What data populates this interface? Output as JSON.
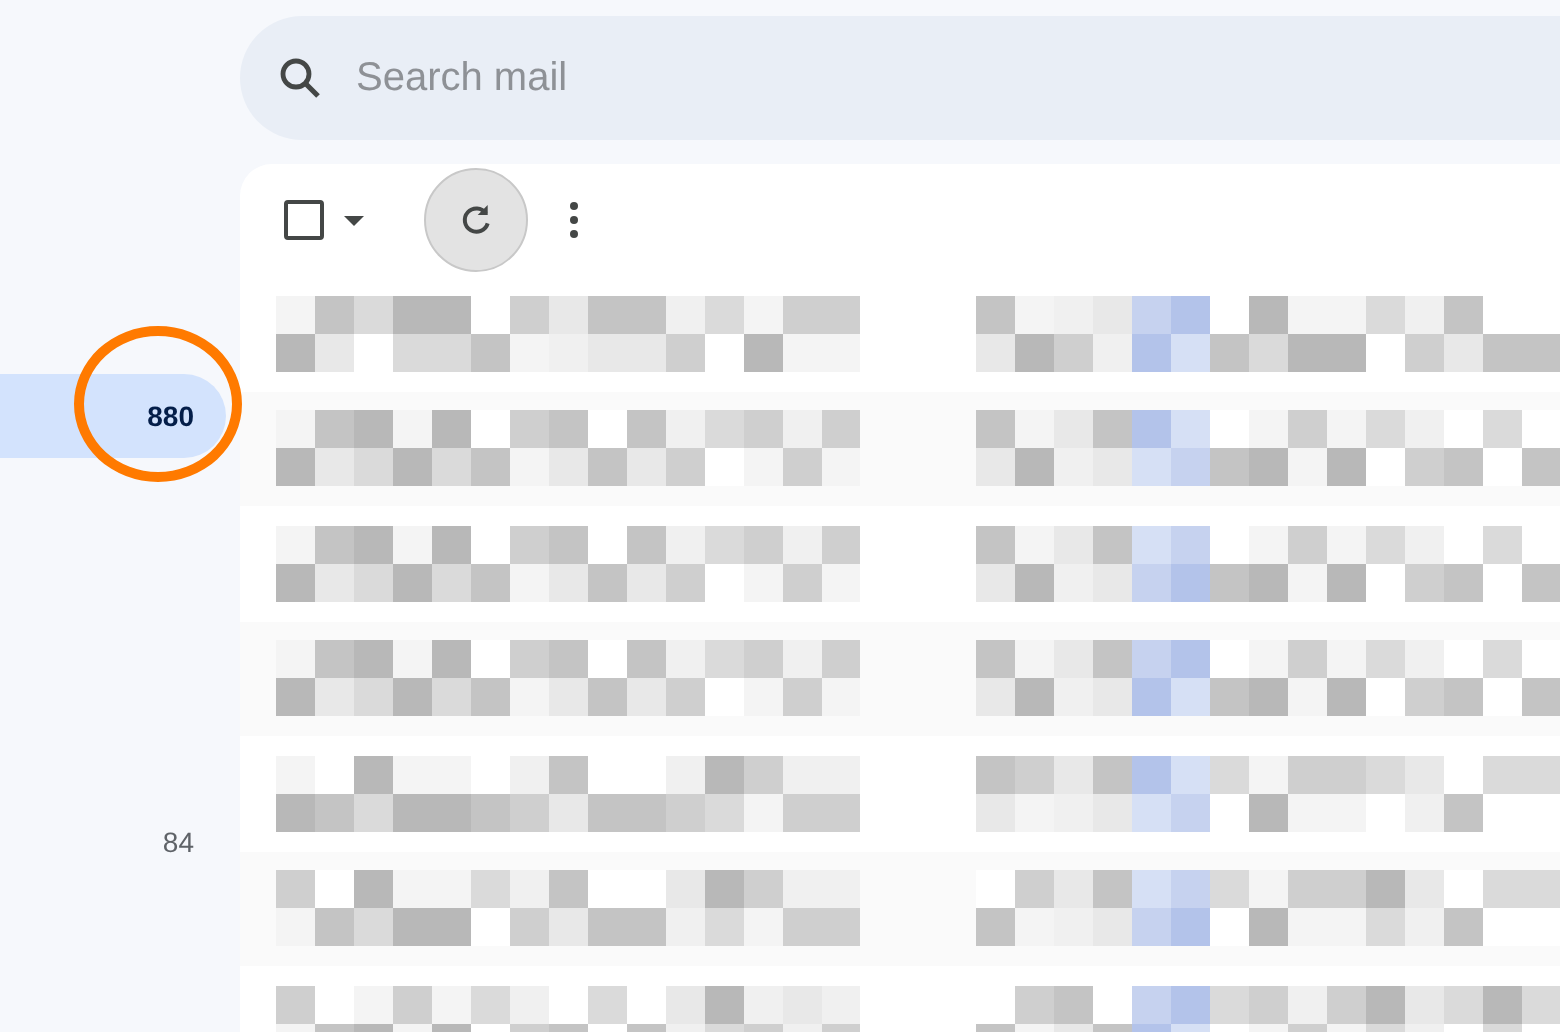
{
  "search": {
    "placeholder": "Search mail"
  },
  "sidebar": {
    "items": [
      {
        "count": "880",
        "selected": true,
        "annotated": true
      },
      {
        "count": "84",
        "selected": false,
        "annotated": false
      }
    ]
  },
  "toolbar": {
    "select_all": {
      "checked": false
    }
  },
  "rows": [
    {
      "kind": "pixelated"
    },
    {
      "kind": "pixelated"
    },
    {
      "kind": "pixelated"
    },
    {
      "kind": "pixelated"
    },
    {
      "kind": "pixelated"
    },
    {
      "kind": "pixelated"
    },
    {
      "kind": "pixelated"
    }
  ]
}
